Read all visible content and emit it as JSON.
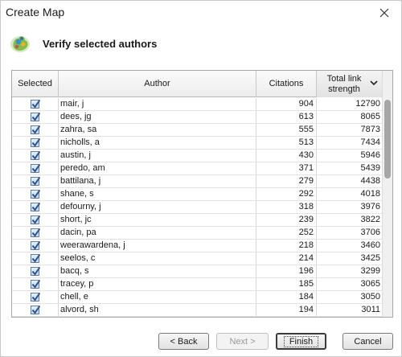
{
  "window": {
    "title": "Create Map"
  },
  "header": {
    "title": "Verify selected authors",
    "icon": "map-logo-icon"
  },
  "table": {
    "columns": {
      "selected": "Selected",
      "author": "Author",
      "citations": "Citations",
      "tls_line1": "Total link",
      "tls_line2": "strength"
    },
    "sort": {
      "column": "Total link strength",
      "direction": "descending"
    },
    "rows": [
      {
        "selected": true,
        "author": "mair, j",
        "citations": "904",
        "tls": "12790"
      },
      {
        "selected": true,
        "author": "dees, jg",
        "citations": "613",
        "tls": "8065"
      },
      {
        "selected": true,
        "author": "zahra, sa",
        "citations": "555",
        "tls": "7873"
      },
      {
        "selected": true,
        "author": "nicholls, a",
        "citations": "513",
        "tls": "7434"
      },
      {
        "selected": true,
        "author": "austin, j",
        "citations": "430",
        "tls": "5946"
      },
      {
        "selected": true,
        "author": "peredo, am",
        "citations": "371",
        "tls": "5439"
      },
      {
        "selected": true,
        "author": "battilana, j",
        "citations": "279",
        "tls": "4438"
      },
      {
        "selected": true,
        "author": "shane, s",
        "citations": "292",
        "tls": "4018"
      },
      {
        "selected": true,
        "author": "defourny, j",
        "citations": "318",
        "tls": "3976"
      },
      {
        "selected": true,
        "author": "short, jc",
        "citations": "239",
        "tls": "3822"
      },
      {
        "selected": true,
        "author": "dacin, pa",
        "citations": "252",
        "tls": "3706"
      },
      {
        "selected": true,
        "author": "weerawardena, j",
        "citations": "218",
        "tls": "3460"
      },
      {
        "selected": true,
        "author": "seelos, c",
        "citations": "214",
        "tls": "3425"
      },
      {
        "selected": true,
        "author": "bacq, s",
        "citations": "196",
        "tls": "3299"
      },
      {
        "selected": true,
        "author": "tracey, p",
        "citations": "185",
        "tls": "3065"
      },
      {
        "selected": true,
        "author": "chell, e",
        "citations": "184",
        "tls": "3050"
      },
      {
        "selected": true,
        "author": "alvord, sh",
        "citations": "194",
        "tls": "3011"
      }
    ]
  },
  "buttons": {
    "back": "< Back",
    "next": "Next >",
    "finish": "Finish",
    "cancel": "Cancel"
  },
  "colors": {
    "checkbox_border": "#5a7ea6",
    "checkmark": "#2a5694"
  }
}
